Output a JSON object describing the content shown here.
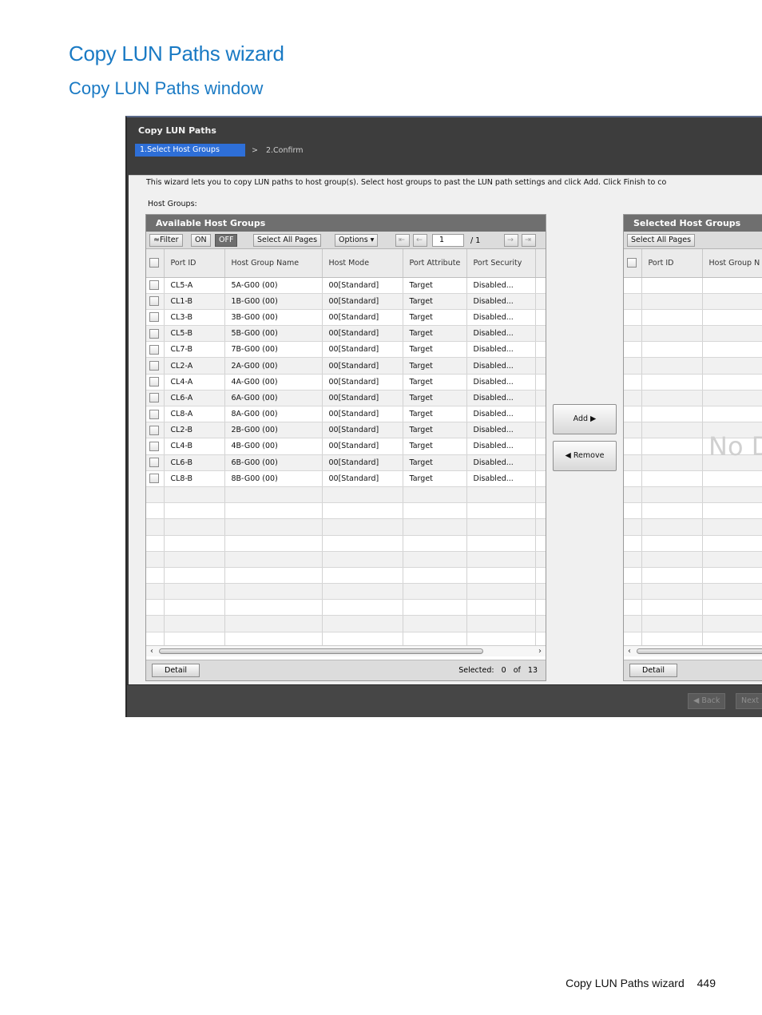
{
  "document": {
    "title": "Copy LUN Paths wizard",
    "subtitle": "Copy LUN Paths window",
    "footer_text": "Copy LUN Paths wizard",
    "page_number": "449"
  },
  "window": {
    "title": "Copy LUN Paths",
    "steps": [
      {
        "label": "1.Select Host Groups",
        "active": true
      },
      {
        "label": "2.Confirm",
        "active": false
      }
    ],
    "step_separator": ">",
    "intro": "This wizard lets you to copy LUN paths to host group(s). Select host groups to past the LUN path settings and click Add. Click Finish to co",
    "host_groups_label": "Host Groups:"
  },
  "available": {
    "heading": "Available Host Groups",
    "toolbar": {
      "filter": "≈Filter",
      "on": "ON",
      "off": "OFF",
      "select_all": "Select All Pages",
      "options": "Options ▾",
      "page_value": "1",
      "page_total": "/ 1"
    },
    "columns": [
      "Port ID",
      "Host Group Name",
      "Host Mode",
      "Port Attribute",
      "Port Security"
    ],
    "rows": [
      [
        "CL5-A",
        "5A-G00 (00)",
        "00[Standard]",
        "Target",
        "Disabled..."
      ],
      [
        "CL1-B",
        "1B-G00 (00)",
        "00[Standard]",
        "Target",
        "Disabled..."
      ],
      [
        "CL3-B",
        "3B-G00 (00)",
        "00[Standard]",
        "Target",
        "Disabled..."
      ],
      [
        "CL5-B",
        "5B-G00 (00)",
        "00[Standard]",
        "Target",
        "Disabled..."
      ],
      [
        "CL7-B",
        "7B-G00 (00)",
        "00[Standard]",
        "Target",
        "Disabled..."
      ],
      [
        "CL2-A",
        "2A-G00 (00)",
        "00[Standard]",
        "Target",
        "Disabled..."
      ],
      [
        "CL4-A",
        "4A-G00 (00)",
        "00[Standard]",
        "Target",
        "Disabled..."
      ],
      [
        "CL6-A",
        "6A-G00 (00)",
        "00[Standard]",
        "Target",
        "Disabled..."
      ],
      [
        "CL8-A",
        "8A-G00 (00)",
        "00[Standard]",
        "Target",
        "Disabled..."
      ],
      [
        "CL2-B",
        "2B-G00 (00)",
        "00[Standard]",
        "Target",
        "Disabled..."
      ],
      [
        "CL4-B",
        "4B-G00 (00)",
        "00[Standard]",
        "Target",
        "Disabled..."
      ],
      [
        "CL6-B",
        "6B-G00 (00)",
        "00[Standard]",
        "Target",
        "Disabled..."
      ],
      [
        "CL8-B",
        "8B-G00 (00)",
        "00[Standard]",
        "Target",
        "Disabled..."
      ]
    ],
    "detail_button": "Detail",
    "selected_label": "Selected:",
    "selected_count": "0",
    "of_label": "of",
    "total_count": "13"
  },
  "actions": {
    "add": "Add ▶",
    "remove": "◀ Remove"
  },
  "selected": {
    "heading": "Selected Host Groups",
    "select_all": "Select All Pages",
    "columns": [
      "Port ID",
      "Host Group N"
    ],
    "empty_text": "No D",
    "detail_button": "Detail"
  },
  "footer": {
    "back": "◀ Back",
    "next": "Next"
  }
}
